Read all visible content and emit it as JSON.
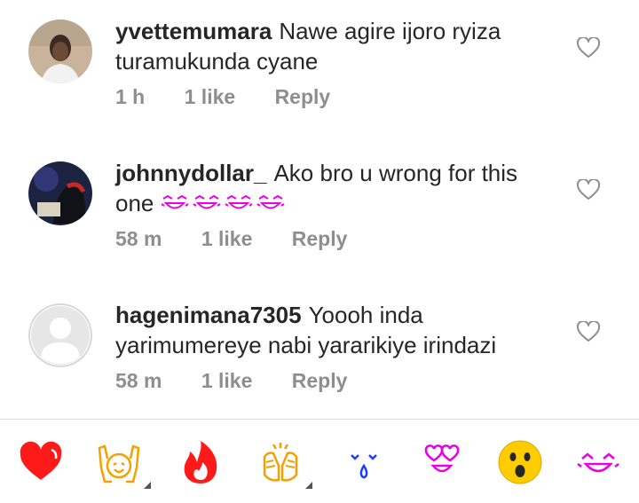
{
  "comments": [
    {
      "username": "yvettemumara",
      "text": "Nawe agire ijoro ryiza turamukunda cyane",
      "time": "1 h",
      "likes": "1 like",
      "reply": "Reply",
      "avatar": "photo-avatar"
    },
    {
      "username": "johnnydollar_",
      "text": "Ako bro u wrong for this one",
      "emoji_suffix": [
        "laughing-face-emoji",
        "laughing-face-emoji",
        "laughing-face-emoji",
        "laughing-face-emoji"
      ],
      "time": "58 m",
      "likes": "1 like",
      "reply": "Reply",
      "avatar": "photo-avatar"
    },
    {
      "username": "hagenimana7305",
      "text": "Yoooh inda yarimumereye nabi yararikiye irindazi",
      "time": "58 m",
      "likes": "1 like",
      "reply": "Reply",
      "avatar": "default-avatar"
    }
  ],
  "emoji_tray": [
    {
      "name": "red-heart",
      "has_variants": false
    },
    {
      "name": "raising-hands",
      "has_variants": true
    },
    {
      "name": "fire",
      "has_variants": false
    },
    {
      "name": "clapping-hands",
      "has_variants": true
    },
    {
      "name": "crying-face",
      "has_variants": false
    },
    {
      "name": "heart-eyes-face",
      "has_variants": false
    },
    {
      "name": "surprised-face",
      "has_variants": false
    },
    {
      "name": "laughing-face",
      "has_variants": false
    }
  ],
  "colors": {
    "text": "#262626",
    "meta": "#8e8e8e",
    "divider": "#dbdbdb",
    "emoji_magenta": "#e900e9",
    "emoji_orange": "#f4a000",
    "emoji_red": "#ff1a1a",
    "emoji_blue": "#1a3cff",
    "emoji_yellow": "#ffcc00"
  }
}
